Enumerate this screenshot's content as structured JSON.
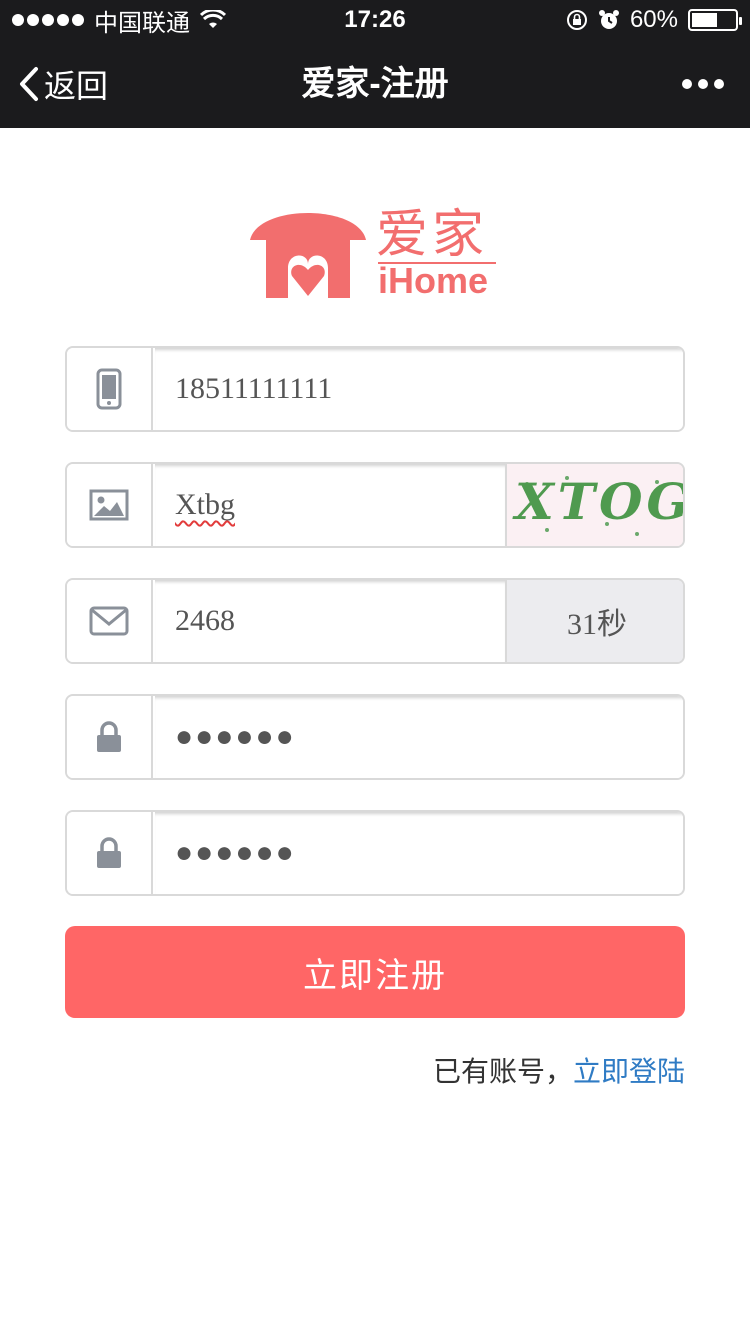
{
  "status_bar": {
    "carrier": "中国联通",
    "time": "17:26",
    "battery_percent": "60%",
    "battery_level": 0.6
  },
  "nav": {
    "back_label": "返回",
    "title": "爱家-注册"
  },
  "logo": {
    "cn": "爱家",
    "en": "iHome",
    "color": "#f26e6e"
  },
  "form": {
    "phone": {
      "value": "18511111111",
      "icon": "mobile-phone-icon"
    },
    "image_code": {
      "value": "Xtbg",
      "icon": "image-icon",
      "captcha_text": "XTOG"
    },
    "sms_code": {
      "value": "2468",
      "icon": "envelope-icon",
      "countdown": "31秒"
    },
    "password": {
      "value": "●●●●●●",
      "icon": "lock-icon"
    },
    "password_confirm": {
      "value": "●●●●●●",
      "icon": "lock-icon"
    }
  },
  "submit": {
    "label": "立即注册",
    "color": "#ff6666"
  },
  "login_prompt": {
    "text": "已有账号，",
    "link": "立即登陆",
    "link_color": "#2f7bc4"
  }
}
